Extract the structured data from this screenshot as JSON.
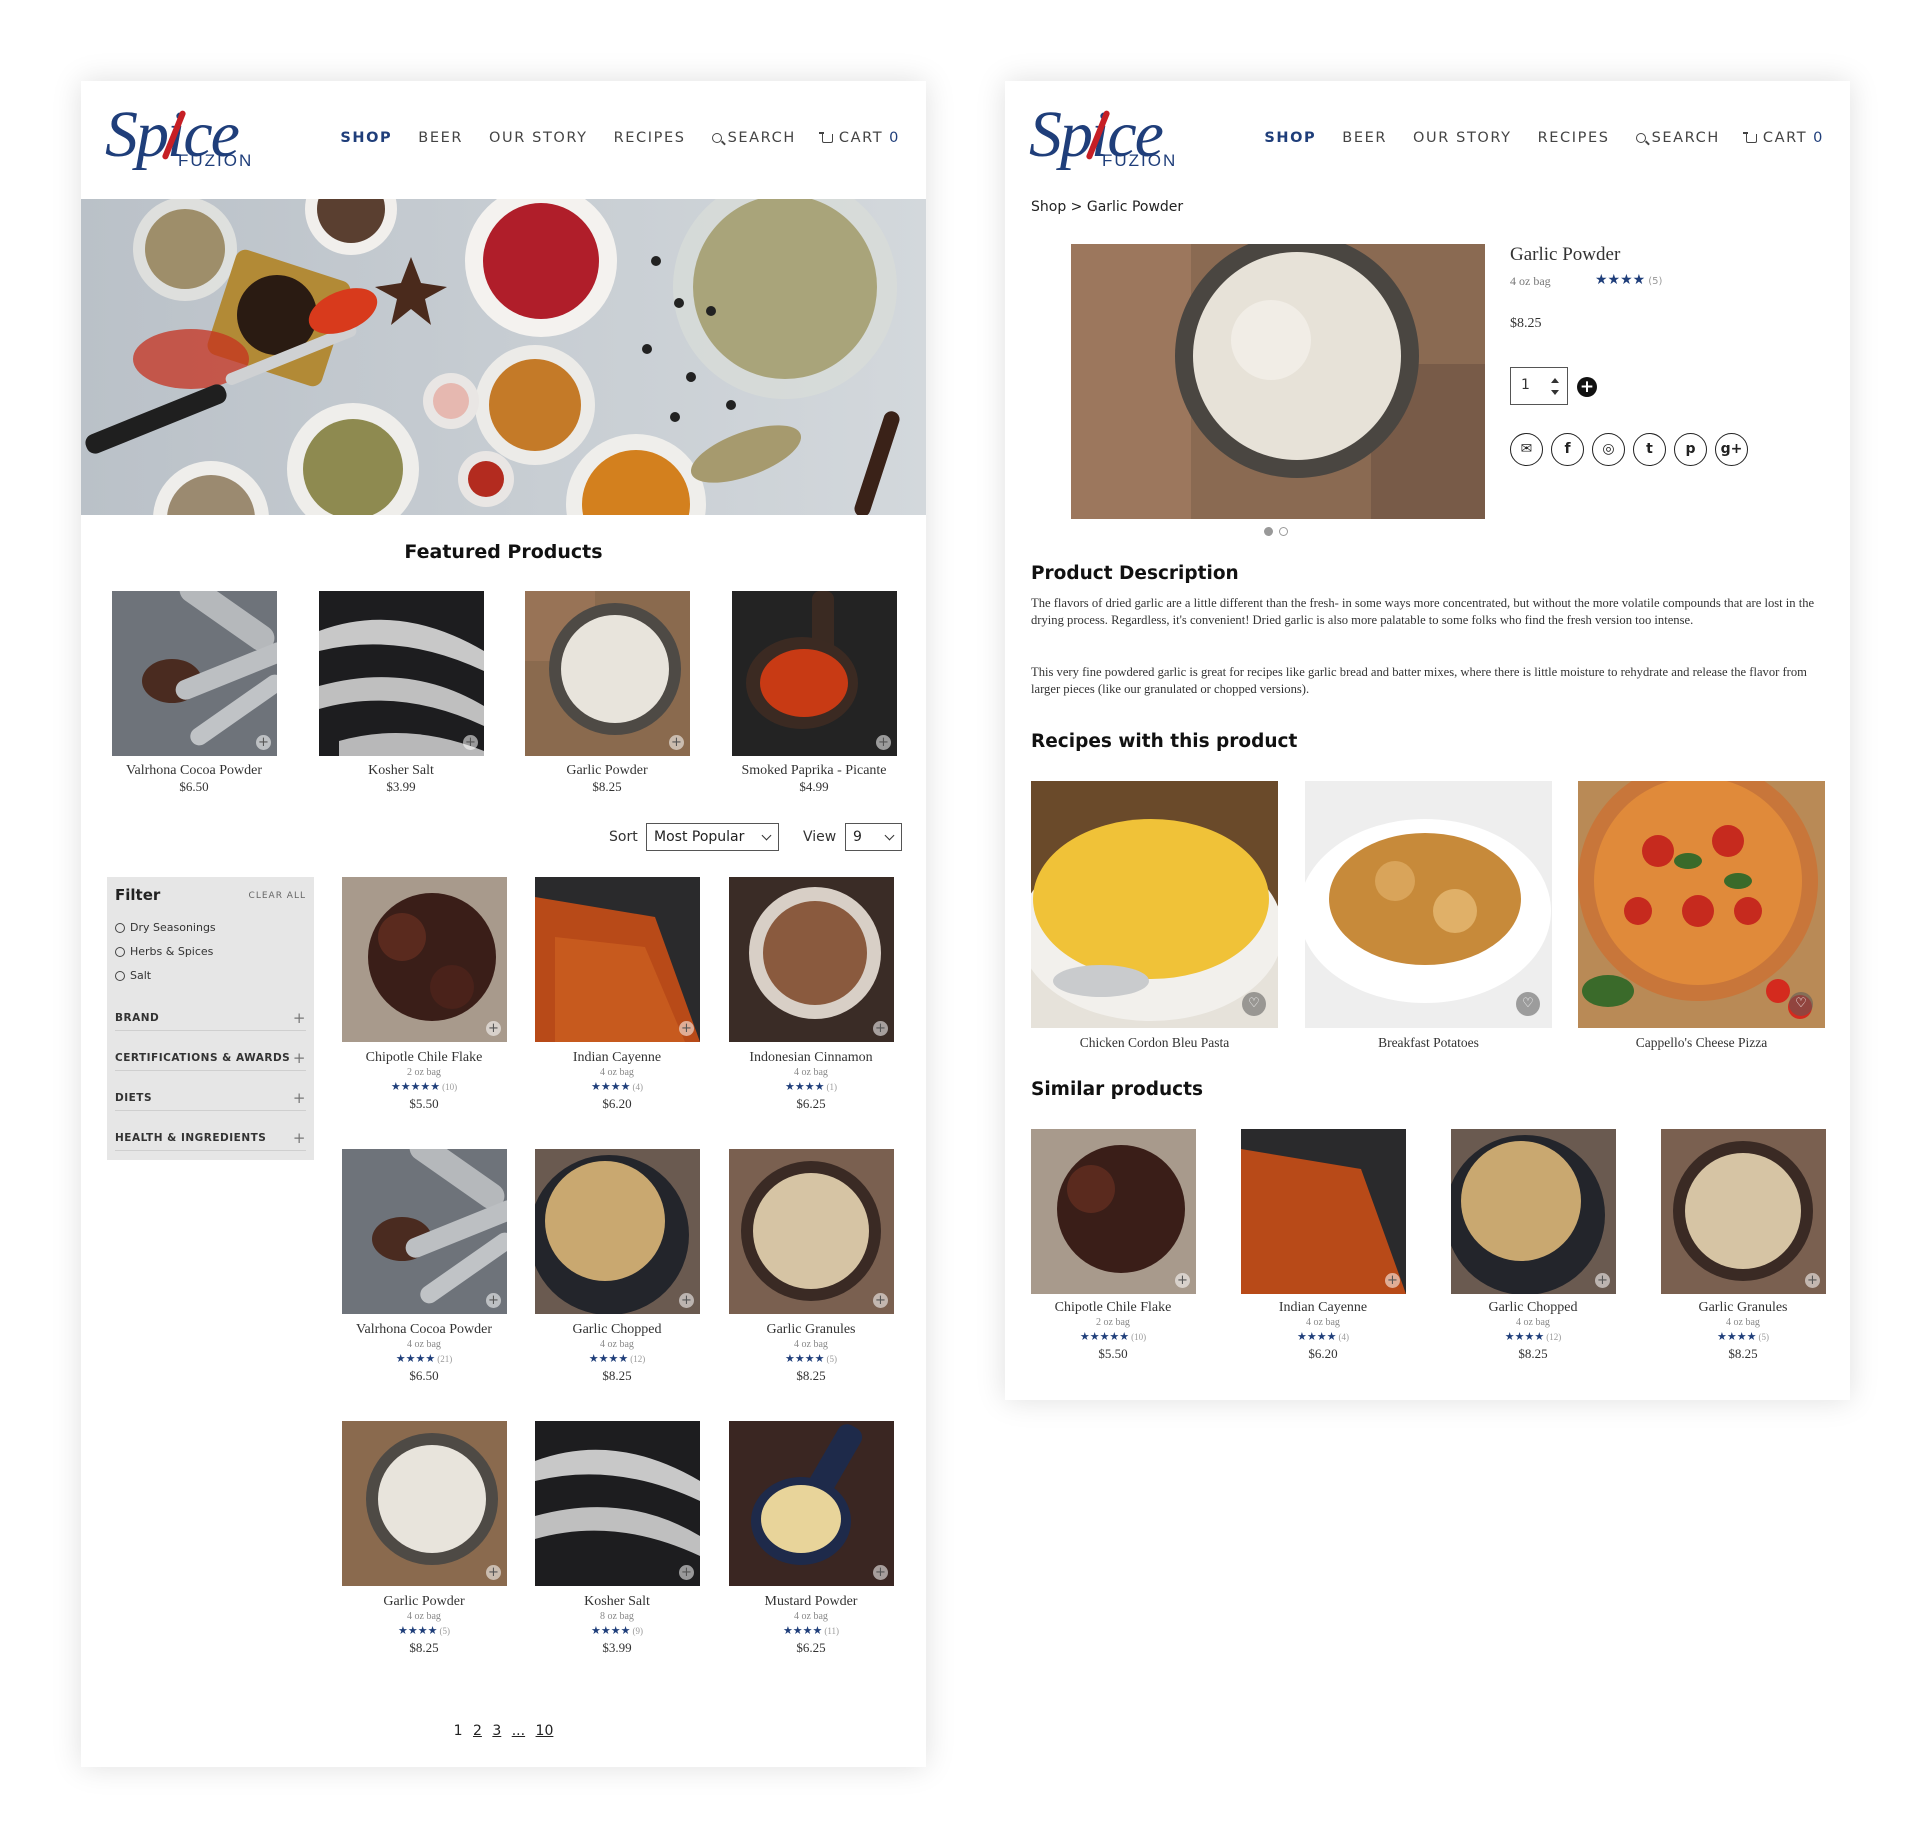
{
  "brand": {
    "logo_main": "Spice",
    "logo_sub": "FUZION"
  },
  "nav": {
    "items": [
      "SHOP",
      "BEER",
      "OUR STORY",
      "RECIPES",
      "SEARCH",
      "CART"
    ],
    "cart_count": "0",
    "active": "SHOP",
    "search_icon": "search-icon",
    "cart_icon": "cart-icon"
  },
  "colors": {
    "brand_blue": "#1f3e7a",
    "brand_red": "#c61f25",
    "filter_bg": "#e6e6e6"
  },
  "listing": {
    "featured_title": "Featured Products",
    "featured": [
      {
        "name": "Valrhona Cocoa Powder",
        "price": "$6.50"
      },
      {
        "name": "Kosher Salt",
        "price": "$3.99"
      },
      {
        "name": "Garlic Powder",
        "price": "$8.25"
      },
      {
        "name": "Smoked Paprika - Picante",
        "price": "$4.99"
      }
    ],
    "sort_label": "Sort",
    "sort_value": "Most Popular",
    "view_label": "View",
    "view_value": "9",
    "filter": {
      "title": "Filter",
      "clear_all": "CLEAR ALL",
      "options": [
        "Dry Seasonings",
        "Herbs & Spices",
        "Salt"
      ],
      "groups": [
        "BRAND",
        "CERTIFICATIONS & AWARDS",
        "DIETS",
        "HEALTH & INGREDIENTS"
      ]
    },
    "products": [
      {
        "name": "Chipotle Chile Flake",
        "size": "2 oz bag",
        "stars": "★★★★★",
        "count": "(10)",
        "price": "$5.50"
      },
      {
        "name": "Indian Cayenne",
        "size": "4 oz bag",
        "stars": "★★★★",
        "count": "(4)",
        "price": "$6.20"
      },
      {
        "name": "Indonesian Cinnamon",
        "size": "4 oz bag",
        "stars": "★★★★",
        "count": "(1)",
        "price": "$6.25"
      },
      {
        "name": "Valrhona Cocoa Powder",
        "size": "4 oz bag",
        "stars": "★★★★",
        "count": "(21)",
        "price": "$6.50"
      },
      {
        "name": "Garlic Chopped",
        "size": "4 oz bag",
        "stars": "★★★★",
        "count": "(12)",
        "price": "$8.25"
      },
      {
        "name": "Garlic Granules",
        "size": "4 oz bag",
        "stars": "★★★★",
        "count": "(5)",
        "price": "$8.25"
      },
      {
        "name": "Garlic Powder",
        "size": "4 oz bag",
        "stars": "★★★★",
        "count": "(5)",
        "price": "$8.25"
      },
      {
        "name": "Kosher Salt",
        "size": "8 oz bag",
        "stars": "★★★★",
        "count": "(9)",
        "price": "$3.99"
      },
      {
        "name": "Mustard Powder",
        "size": "4 oz bag",
        "stars": "★★★★",
        "count": "(11)",
        "price": "$6.25"
      }
    ],
    "pagination": {
      "pages": [
        "1",
        "2",
        "3"
      ],
      "ellipsis": "...",
      "last": "10"
    }
  },
  "detail": {
    "breadcrumb": "Shop > Garlic Powder",
    "title": "Garlic Powder",
    "size": "4 oz bag",
    "stars": "★★★★",
    "count": "(5)",
    "price": "$8.25",
    "qty": "1",
    "add_label": "+",
    "social": [
      "email-icon",
      "facebook-icon",
      "instagram-icon",
      "twitter-icon",
      "pinterest-icon",
      "google-plus-icon"
    ],
    "desc_title": "Product Description",
    "desc_p1": "The flavors of dried garlic are a little different than the fresh- in some ways more concentrated, but without the more volatile compounds that are lost in the drying process. Regardless, it's convenient! Dried garlic is also more palatable to some folks who find the fresh version too intense.",
    "desc_p2": "This very fine powdered garlic is great for recipes like garlic bread and batter mixes, where there is little moisture to rehydrate and release the flavor from larger pieces (like our granulated or chopped versions).",
    "recipes_title": "Recipes with this product",
    "recipes": [
      "Chicken Cordon Bleu Pasta",
      "Breakfast Potatoes",
      "Cappello's Cheese Pizza"
    ],
    "similar_title": "Similar products",
    "similar": [
      {
        "name": "Chipotle Chile Flake",
        "size": "2 oz bag",
        "stars": "★★★★★",
        "count": "(10)",
        "price": "$5.50"
      },
      {
        "name": "Indian Cayenne",
        "size": "4 oz bag",
        "stars": "★★★★",
        "count": "(4)",
        "price": "$6.20"
      },
      {
        "name": "Garlic Chopped",
        "size": "4 oz bag",
        "stars": "★★★★",
        "count": "(12)",
        "price": "$8.25"
      },
      {
        "name": "Garlic Granules",
        "size": "4 oz bag",
        "stars": "★★★★",
        "count": "(5)",
        "price": "$8.25"
      }
    ]
  }
}
